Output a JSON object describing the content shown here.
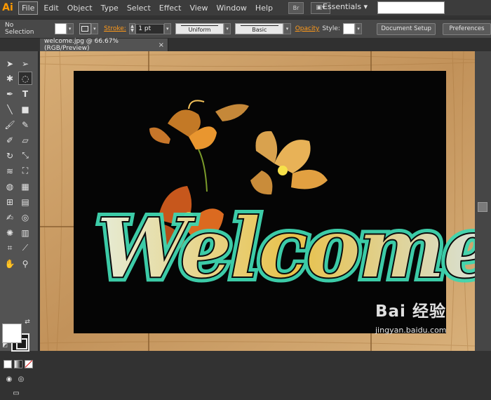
{
  "app": {
    "logo": "Ai"
  },
  "menu": {
    "items": [
      {
        "label": "File",
        "active": true
      },
      {
        "label": "Edit"
      },
      {
        "label": "Object"
      },
      {
        "label": "Type"
      },
      {
        "label": "Select"
      },
      {
        "label": "Effect"
      },
      {
        "label": "View"
      },
      {
        "label": "Window"
      },
      {
        "label": "Help"
      }
    ],
    "bridge_label": "Br",
    "workspace": "Essentials ▾"
  },
  "control": {
    "selection_label": "No Selection",
    "stroke_label": "Stroke:",
    "stroke_value": "1 pt",
    "profile_uniform": "Uniform",
    "brush_basic": "Basic",
    "opacity_label": "Opacity",
    "style_label": "Style:",
    "document_setup": "Document Setup",
    "preferences": "Preferences"
  },
  "document": {
    "tab_title": "welcome.jpg @ 66.67% (RGB/Preview)",
    "close_glyph": "×",
    "artwork_text": "Welcome"
  },
  "watermark": {
    "title": "Bai 经验",
    "url": "jingyan.baidu.com"
  },
  "colors": {
    "accent_orange": "#ff9a00",
    "chalk_teal": "#3fd6b0",
    "chalk_yellow": "#e8c14a",
    "flower_orange": "#e07a22",
    "chalkboard": "#050505",
    "wood_frame": "#c99a63"
  }
}
